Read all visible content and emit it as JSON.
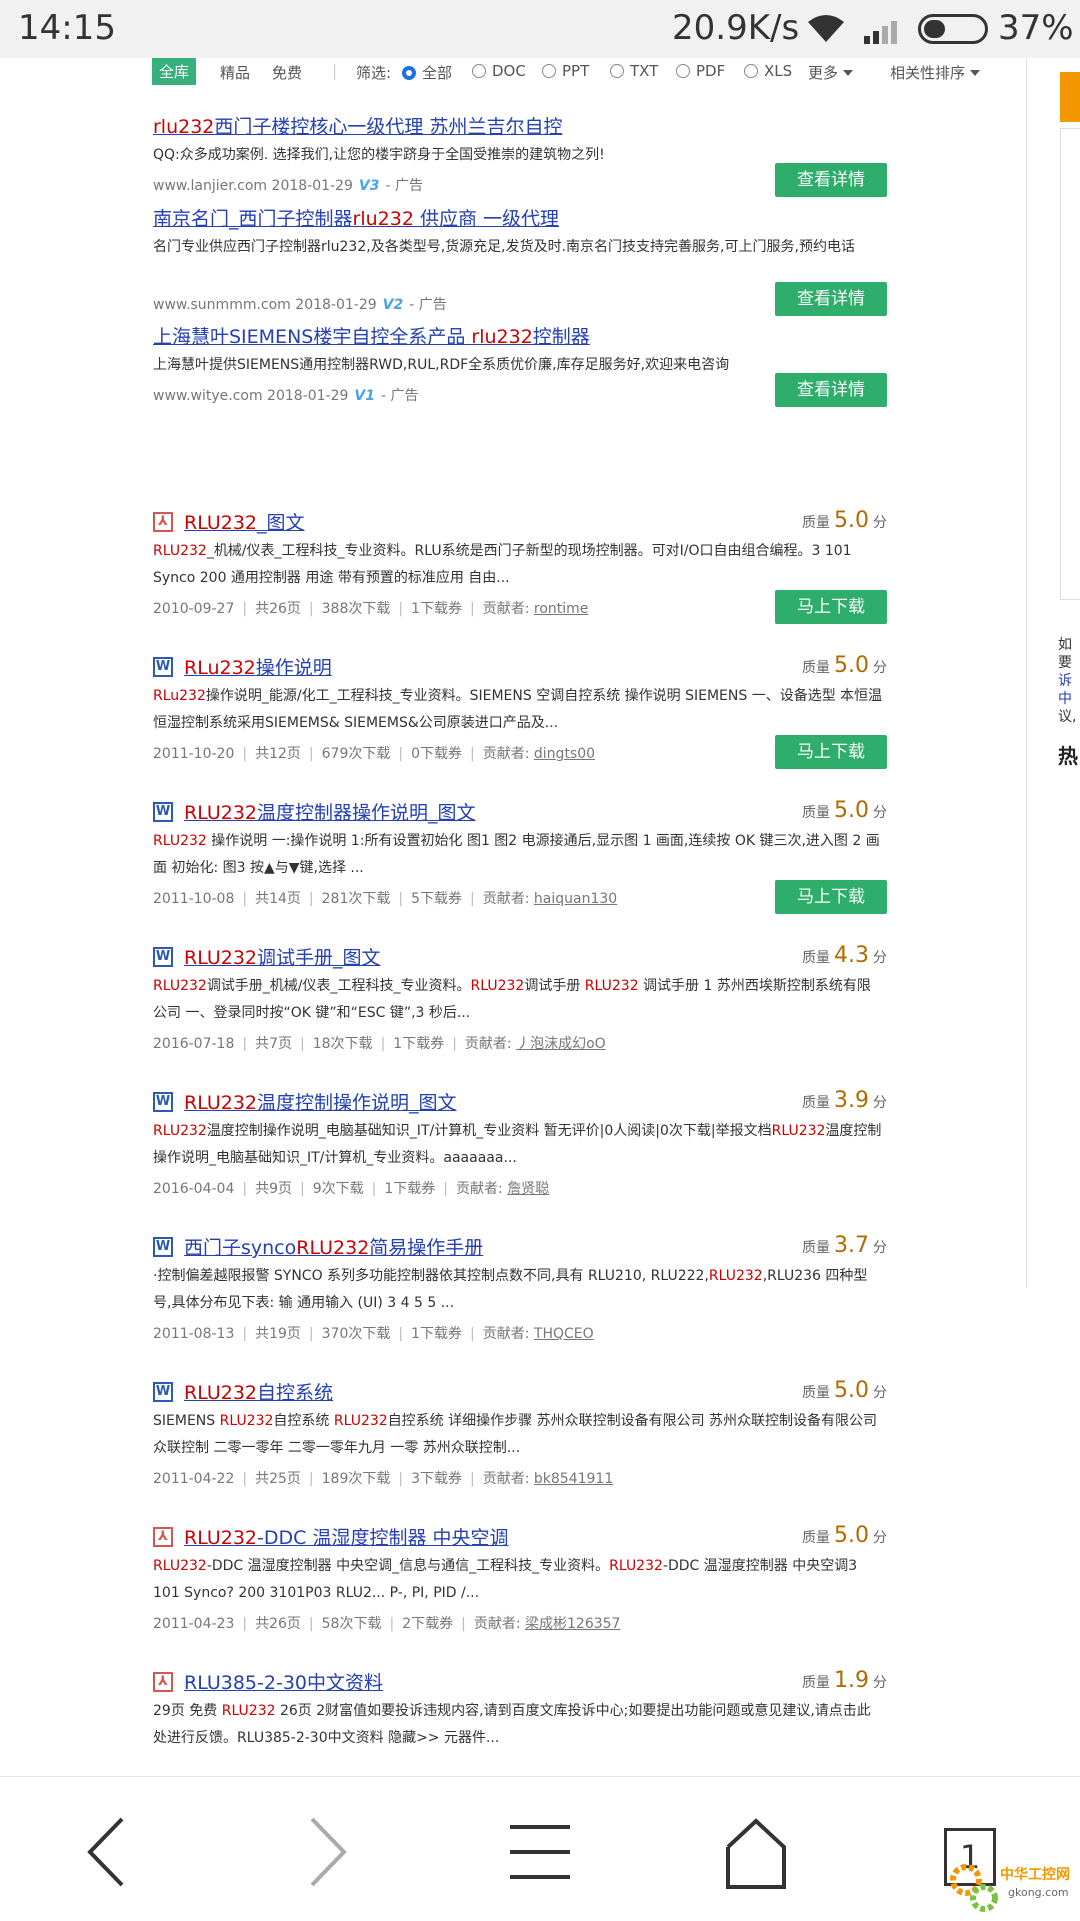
{
  "status_bar": {
    "time": "14:15",
    "speed": "20.9K/s",
    "battery_pct": "37%",
    "battery_level": 0.37
  },
  "filter": {
    "tabs": [
      "全库",
      "精品",
      "免费"
    ],
    "label": "筛选:",
    "options": [
      "全部",
      "DOC",
      "PPT",
      "TXT",
      "PDF",
      "XLS"
    ],
    "selected": "全部",
    "more": "更多",
    "sort": "相关性排序"
  },
  "ads": [
    {
      "title": "rlu232西门子楼控核心一级代理 苏州兰吉尔自控",
      "title_hl": "rlu232",
      "desc": "QQ:众多成功案例. 选择我们,让您的楼宇跻身于全国受推崇的建筑物之列!",
      "site": "www.lanjier.com",
      "date": "2018-01-29",
      "badge": "V3",
      "tag": "- 广告",
      "button": "查看详情"
    },
    {
      "title": "南京名门_西门子控制器rlu232 供应商 一级代理",
      "desc": "名门专业供应西门子控制器rlu232,及各类型号,货源充足,发货及时.南京名门技支持完善服务,可上门服务,预约电话",
      "site": "www.sunmmm.com",
      "date": "2018-01-29",
      "badge": "V2",
      "tag": "- 广告",
      "button": "查看详情"
    },
    {
      "title": "上海慧叶SIEMENS楼宇自控全系产品 rlu232控制器",
      "desc": "上海慧叶提供SIEMENS通用控制器RWD,RUL,RDF全系质优价廉,库存足服务好,欢迎来电咨询",
      "site": "www.witye.com",
      "date": "2018-01-29",
      "badge": "V1",
      "tag": "- 广告",
      "button": "查看详情"
    }
  ],
  "results": [
    {
      "icon": "pdf",
      "title": "RLU232_图文",
      "quality_label": "质量",
      "score": "5.0",
      "unit": "分",
      "desc": "RLU232_机械/仪表_工程科技_专业资料。RLU系统是西门子新型的现场控制器。可对I/O口自由组合编程。3 101 Synco 200 通用控制器 用途 带有预置的标准应用 自由...",
      "date": "2010-09-27",
      "pages": "共26页",
      "downloads": "388次下载",
      "tickets": "1下载券",
      "contrib_label": "贡献者:",
      "contributor": "rontime",
      "button": "马上下载"
    },
    {
      "icon": "doc",
      "title": "RLu232操作说明",
      "quality_label": "质量",
      "score": "5.0",
      "unit": "分",
      "desc": "RLu232操作说明_能源/化工_工程科技_专业资料。SIEMENS 空调自控系统 操作说明 SIEMENS 一、设备选型 本恒温恒湿控制系统采用SIEMEMS& SIEMEMS&公司原装进口产品及...",
      "date": "2011-10-20",
      "pages": "共12页",
      "downloads": "679次下载",
      "tickets": "0下载券",
      "contrib_label": "贡献者:",
      "contributor": "dingts00",
      "button": "马上下载"
    },
    {
      "icon": "doc",
      "title": "RLU232温度控制器操作说明_图文",
      "quality_label": "质量",
      "score": "5.0",
      "unit": "分",
      "desc": "RLU232 操作说明 一:操作说明 1:所有设置初始化 图1 图2 电源接通后,显示图 1 画面,连续按 OK 键三次,进入图 2 画面 初始化: 图3 按▲与▼键,选择 ...",
      "date": "2011-10-08",
      "pages": "共14页",
      "downloads": "281次下载",
      "tickets": "5下载券",
      "contrib_label": "贡献者:",
      "contributor": "haiquan130",
      "button": "马上下载"
    },
    {
      "icon": "doc",
      "title": "RLU232调试手册_图文",
      "quality_label": "质量",
      "score": "4.3",
      "unit": "分",
      "desc": "RLU232调试手册_机械/仪表_工程科技_专业资料。RLU232调试手册 RLU232 调试手册 1 苏州西埃斯控制系统有限公司 一、登录同时按“OK 键”和“ESC 键”,3 秒后...",
      "date": "2016-07-18",
      "pages": "共7页",
      "downloads": "18次下载",
      "tickets": "1下载券",
      "contrib_label": "贡献者:",
      "contributor": "丿泡沫成幻oO"
    },
    {
      "icon": "doc",
      "title": "RLU232温度控制操作说明_图文",
      "quality_label": "质量",
      "score": "3.9",
      "unit": "分",
      "desc": "RLU232温度控制操作说明_电脑基础知识_IT/计算机_专业资料 暂无评价|0人阅读|0次下载|举报文档RLU232温度控制操作说明_电脑基础知识_IT/计算机_专业资料。aaaaaaa...",
      "date": "2016-04-04",
      "pages": "共9页",
      "downloads": "9次下载",
      "tickets": "1下载券",
      "contrib_label": "贡献者:",
      "contributor": "詹贤聪"
    },
    {
      "icon": "doc",
      "title": "西门子syncoRLU232简易操作手册",
      "quality_label": "质量",
      "score": "3.7",
      "unit": "分",
      "desc": "·控制偏差越限报警 SYNCO 系列多功能控制器依其控制点数不同,具有 RLU210, RLU222,RLU232,RLU236 四种型号,具体分布见下表: 输 通用输入 (UI) 3 4 5 5 ...",
      "date": "2011-08-13",
      "pages": "共19页",
      "downloads": "370次下载",
      "tickets": "1下载券",
      "contrib_label": "贡献者:",
      "contributor": "THQCEO"
    },
    {
      "icon": "doc",
      "title": "RLU232自控系统",
      "quality_label": "质量",
      "score": "5.0",
      "unit": "分",
      "desc": "SIEMENS RLU232自控系统 RLU232自控系统 详细操作步骤 苏州众联控制设备有限公司 苏州众联控制设备有限公司 众联控制 二零一零年 二零一零年九月 一零 苏州众联控制...",
      "date": "2011-04-22",
      "pages": "共25页",
      "downloads": "189次下载",
      "tickets": "3下载券",
      "contrib_label": "贡献者:",
      "contributor": "bk8541911"
    },
    {
      "icon": "pdf",
      "title": "RLU232-DDC 温湿度控制器 中央空调",
      "quality_label": "质量",
      "score": "5.0",
      "unit": "分",
      "desc": "RLU232-DDC 温湿度控制器 中央空调_信息与通信_工程科技_专业资料。RLU232-DDC 温湿度控制器 中央空调3 101 Synco? 200 3101P03 RLU2... P-, PI, PID /...",
      "date": "2011-04-23",
      "pages": "共26页",
      "downloads": "58次下载",
      "tickets": "2下载券",
      "contrib_label": "贡献者:",
      "contributor": "梁成彬126357"
    },
    {
      "icon": "pdf",
      "title": "RLU385-2-30中文资料",
      "quality_label": "质量",
      "score": "1.9",
      "unit": "分",
      "desc": "29页 免费 RLU232 26页 2财富值如要投诉违规内容,请到百度文库投诉中心;如要提出功能问题或意见建议,请点击此处进行反馈。RLU385-2-30中文资料 隐藏>> 元器件..."
    }
  ],
  "sidebar": {
    "text_lines": [
      "如要",
      "诉中",
      "议,"
    ],
    "hot": "热"
  },
  "nav": {
    "tab_count": "1"
  },
  "watermark": {
    "title": "中华工控网",
    "sub": "gkong.com"
  }
}
